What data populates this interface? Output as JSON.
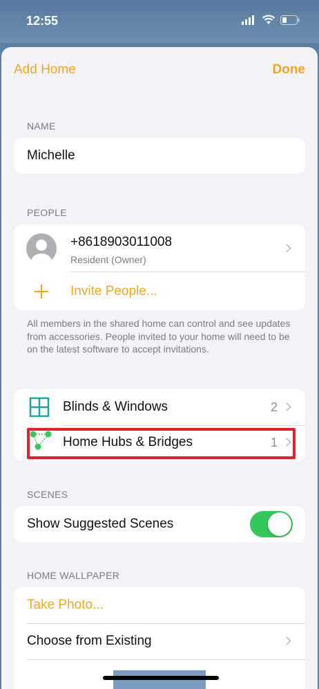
{
  "status_bar": {
    "time": "12:55"
  },
  "nav": {
    "left_label": "Add Home",
    "right_label": "Done"
  },
  "name_section": {
    "label": "NAME",
    "value": "Michelle"
  },
  "people_section": {
    "label": "PEOPLE",
    "member": {
      "phone": "+8618903011008",
      "role": "Resident (Owner)"
    },
    "invite_label": "Invite People...",
    "footnote": "All members in the shared home can control and see updates from accessories. People invited to your home will need to be on the latest software to accept invitations."
  },
  "devices_section": {
    "items": [
      {
        "label": "Blinds & Windows",
        "count": "2",
        "icon": "blinds-icon"
      },
      {
        "label": "Home Hubs & Bridges",
        "count": "1",
        "icon": "hub-icon"
      }
    ]
  },
  "scenes_section": {
    "label": "SCENES",
    "toggle_label": "Show Suggested Scenes",
    "toggle_on": true
  },
  "wallpaper_section": {
    "label": "HOME WALLPAPER",
    "take_photo_label": "Take Photo...",
    "choose_existing_label": "Choose from Existing"
  },
  "colors": {
    "accent": "#f2a71b",
    "toggle_on": "#34c759",
    "highlight": "#e4202a",
    "blinds_icon": "#1aa3a3",
    "hub_icon": "#34c759"
  }
}
